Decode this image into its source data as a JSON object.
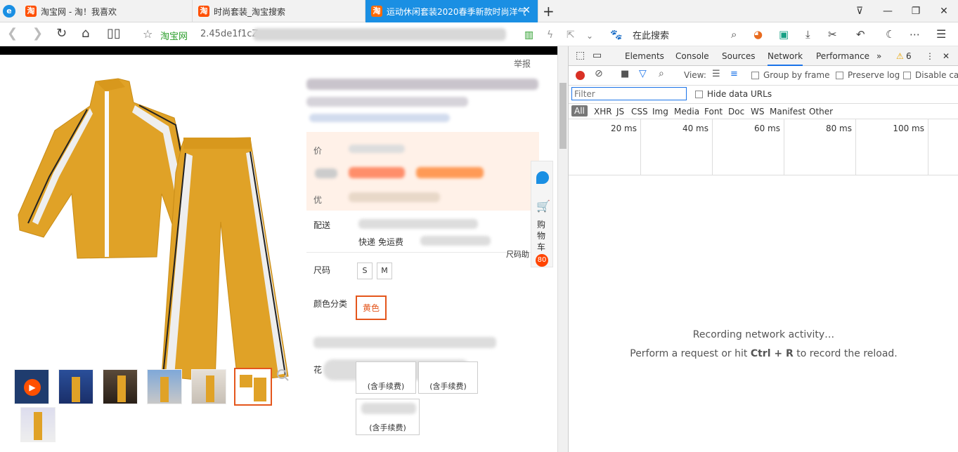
{
  "tabs": [
    {
      "label": "淘宝网 - 淘！我喜欢",
      "fav": "淘"
    },
    {
      "label": "时尚套装_淘宝搜索",
      "fav": "淘"
    },
    {
      "label": "运动休闲套装2020春季新款时尚洋气",
      "fav": "淘"
    }
  ],
  "new_tab": "+",
  "nav": {
    "site_label": "淘宝网",
    "url_text": "2.45de1f1cZ",
    "search_placeholder": "在此搜索"
  },
  "page": {
    "report": "举报",
    "labels": {
      "price": "价",
      "promo": "优",
      "delivery": "配送",
      "size": "尺码",
      "color": "颜色分类",
      "flower": "花"
    },
    "express": "快递",
    "freight": "免运费",
    "size_help": "尺码助",
    "sizes": [
      "S",
      "M"
    ],
    "color_selected": "黄色",
    "fee_labels": [
      "(含手续费)",
      "(含手续费)",
      "(含手续费)"
    ],
    "sidebar": {
      "cart_label": "购物车",
      "cart_count": "80"
    }
  },
  "devtools": {
    "tabs": [
      "Elements",
      "Console",
      "Sources",
      "Network",
      "Performance"
    ],
    "warn_count": "6",
    "view_label": "View:",
    "group_by_frame": "Group by frame",
    "preserve_log": "Preserve log",
    "disable_cache": "Disable cac",
    "filter_placeholder": "Filter",
    "hide_data_urls": "Hide data URLs",
    "types": [
      "All",
      "XHR",
      "JS",
      "CSS",
      "Img",
      "Media",
      "Font",
      "Doc",
      "WS",
      "Manifest",
      "Other"
    ],
    "timeline": [
      "20 ms",
      "40 ms",
      "60 ms",
      "80 ms",
      "100 ms"
    ],
    "recording_title": "Recording network activity…",
    "recording_hint_pre": "Perform a request or hit ",
    "recording_hint_keys": "Ctrl + R",
    "recording_hint_post": " to record the reload."
  },
  "colors": {
    "accent": "#1a8fe3",
    "taobao": "#ff5000",
    "mustard": "#e0a227",
    "select_border": "#e4561c"
  }
}
